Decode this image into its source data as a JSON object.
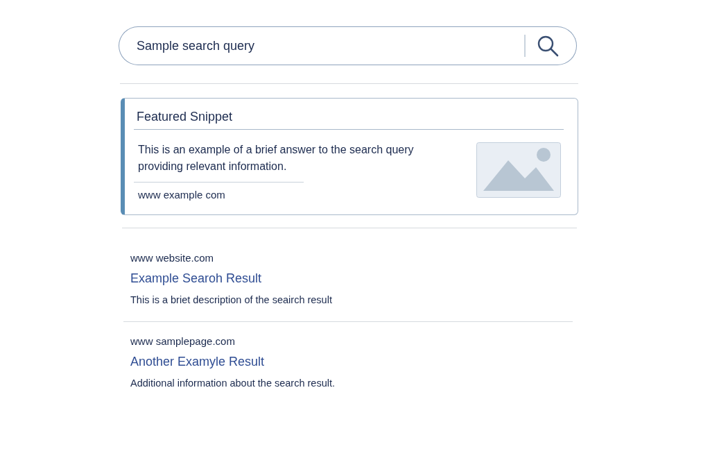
{
  "search": {
    "value": "Sample search query"
  },
  "featured_snippet": {
    "title": "Featured Snippet",
    "answer": "This is an example of a brief answer to the search query providing relevant information.",
    "source": "www example com"
  },
  "results": [
    {
      "url": "www website.com",
      "title": "Example Searoh Result",
      "description": "This is a briet description of the seairch result"
    },
    {
      "url": "www samplepage.com",
      "title": "Another Examyle Result",
      "description": "Additional information about the search result."
    }
  ]
}
